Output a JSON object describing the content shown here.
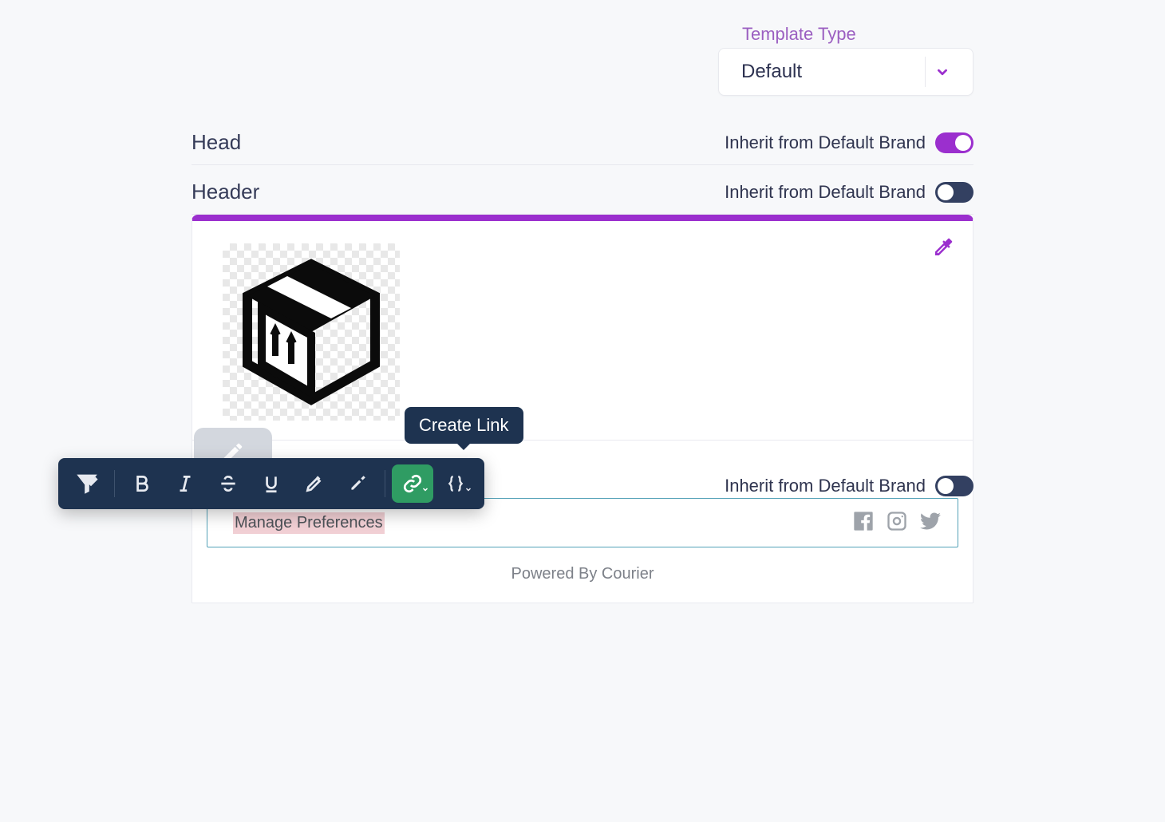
{
  "templateType": {
    "label": "Template Type",
    "value": "Default"
  },
  "sections": {
    "head": {
      "title": "Head",
      "inheritLabel": "Inherit from Default Brand",
      "inheritOn": true
    },
    "header": {
      "title": "Header",
      "inheritLabel": "Inherit from Default Brand",
      "inheritOn": false
    },
    "footer": {
      "inheritLabel": "Inherit from Default Brand",
      "inheritOn": false
    }
  },
  "footerBody": {
    "text": "Manage Preferences"
  },
  "powered": "Powered By Courier",
  "tooltip": "Create Link",
  "colors": {
    "accent": "#9b2fce",
    "toolbarBg": "#1e3350",
    "linkActive": "#2f9c63"
  }
}
